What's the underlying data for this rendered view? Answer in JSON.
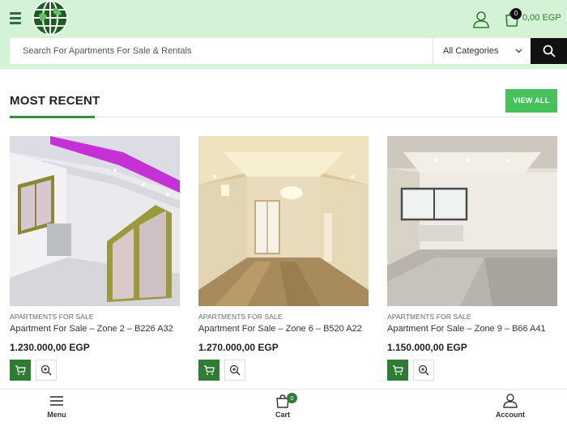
{
  "header": {
    "cart_count": "0",
    "cart_total": "0,00 EGP"
  },
  "search": {
    "placeholder": "Search For Apartments For Sale & Rentals",
    "category": "All Categories"
  },
  "section": {
    "title": "MOST RECENT",
    "view_all": "VIEW ALL"
  },
  "products": [
    {
      "category": "APARTMENTS FOR SALE",
      "name": "Apartment For Sale – Zone 2 – B226 A32",
      "price": "1.230.000,00 EGP"
    },
    {
      "category": "APARTMENTS FOR SALE",
      "name": "Apartment For Sale – Zone 6 – B520 A22",
      "price": "1.270.000,00 EGP"
    },
    {
      "category": "APARTMENTS FOR SALE",
      "name": "Apartment For Sale – Zone 9 – B66 A41",
      "price": "1.150.000,00 EGP"
    }
  ],
  "bottom_nav": {
    "menu": "Menu",
    "cart": "Cart",
    "cart_count": "0",
    "account": "Account"
  },
  "colors": {
    "header_bg": "#d3f2d6",
    "accent_green": "#2e7d32",
    "view_all_bg": "#45c25a"
  }
}
